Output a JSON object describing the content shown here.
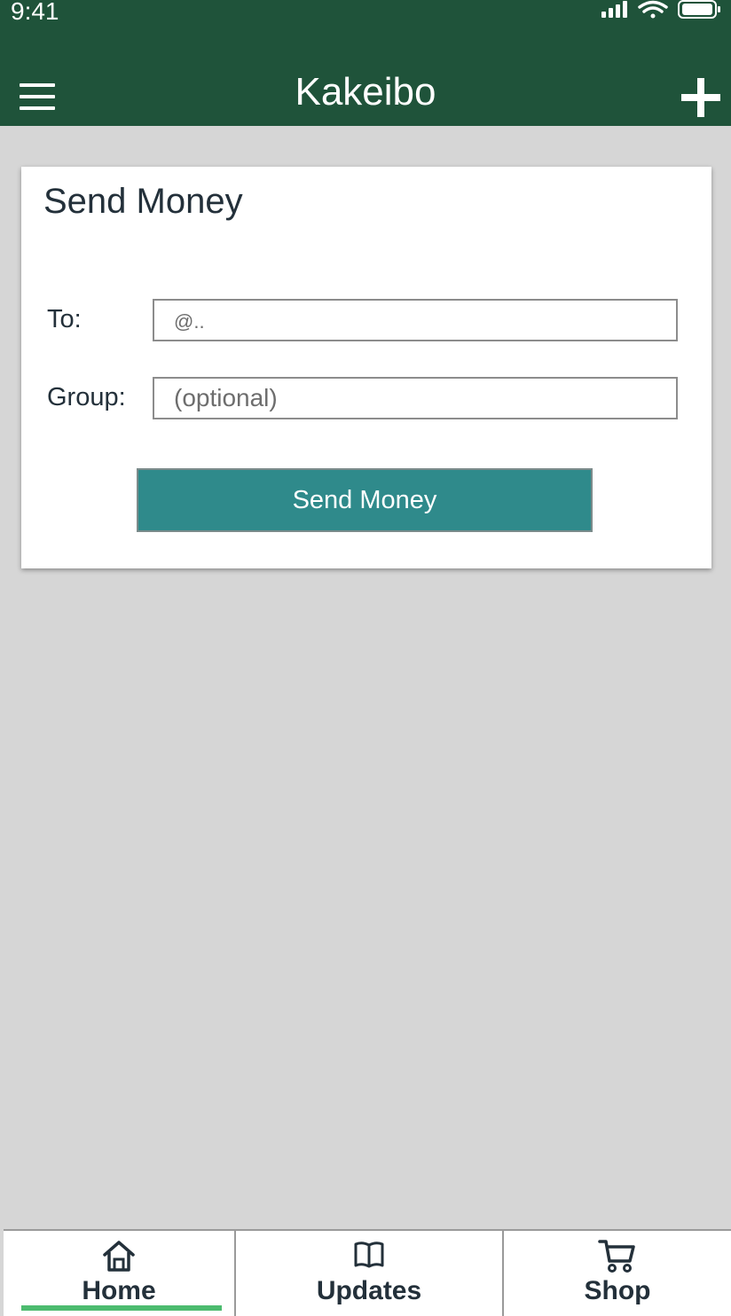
{
  "status_bar": {
    "time": "9:41",
    "icons": [
      "cellular-signal-icon",
      "wifi-icon",
      "battery-icon"
    ]
  },
  "app_bar": {
    "title": "Kakeibo",
    "left_icon": "hamburger-menu-icon",
    "right_icon": "plus-icon"
  },
  "card": {
    "title": "Send Money",
    "to": {
      "label": "To:",
      "placeholder": "@..",
      "value": ""
    },
    "group": {
      "label": "Group:",
      "placeholder": "(optional)",
      "value": ""
    },
    "submit_label": "Send Money"
  },
  "bottom_nav": {
    "items": [
      {
        "label": "Home",
        "icon": "home-icon",
        "active": true
      },
      {
        "label": "Updates",
        "icon": "book-icon",
        "active": false
      },
      {
        "label": "Shop",
        "icon": "shopping-cart-icon",
        "active": false
      }
    ]
  },
  "colors": {
    "app_bar": "#1f533a",
    "background": "#d6d6d6",
    "button": "#2f8a8b",
    "active_indicator": "#4cbb6f",
    "text": "#23303a"
  }
}
